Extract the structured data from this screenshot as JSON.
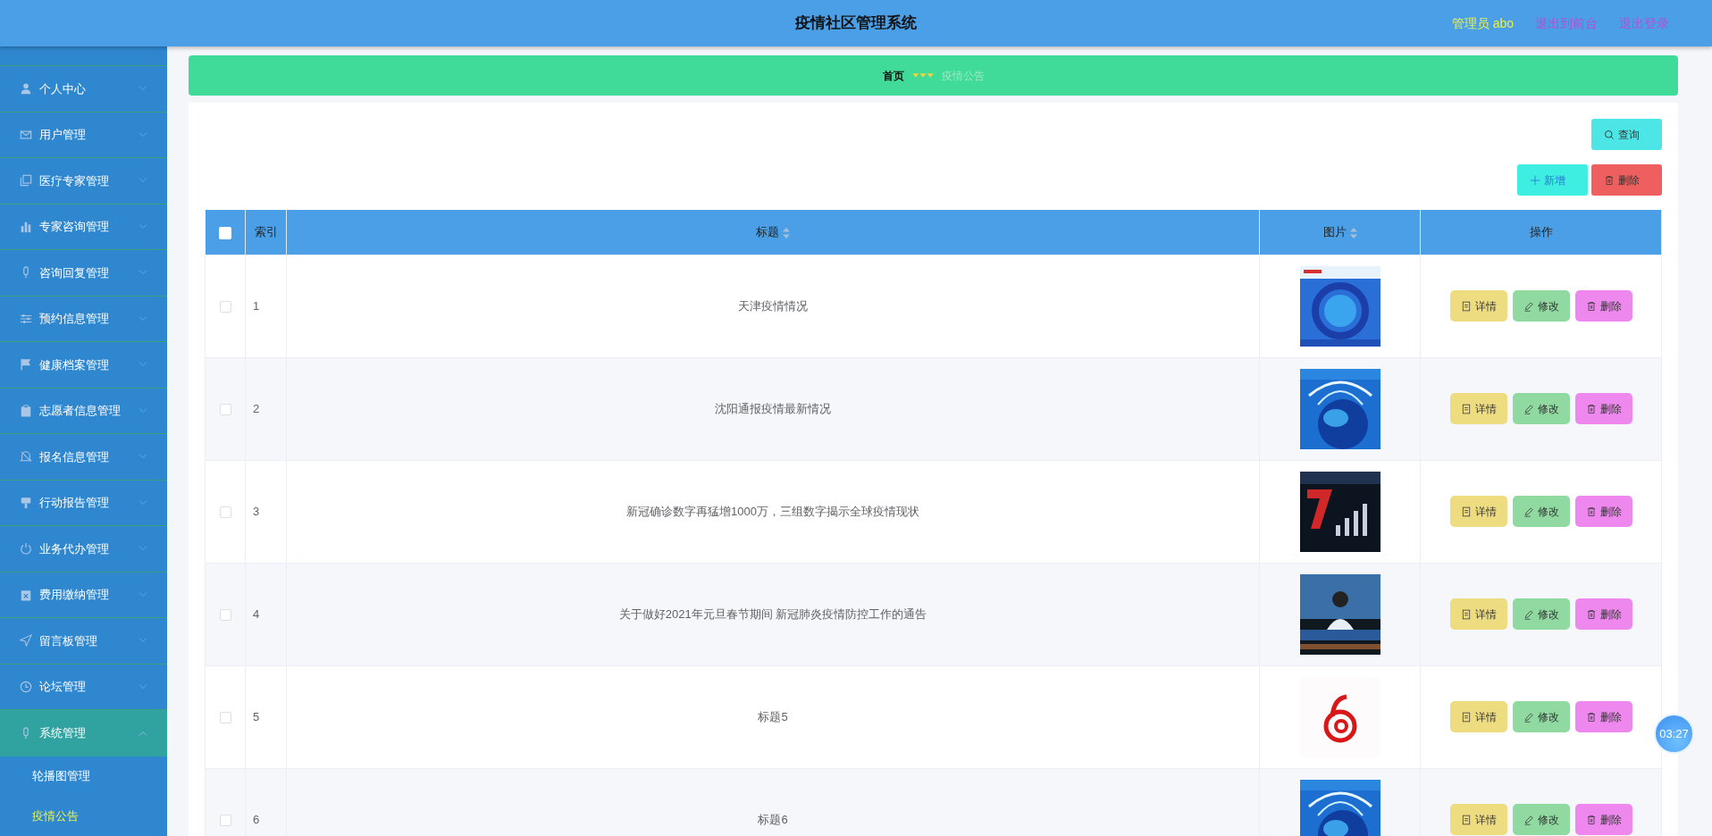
{
  "header": {
    "title": "疫情社区管理系统",
    "user": "管理员 abo",
    "links": [
      "退出到前台",
      "退出登录"
    ]
  },
  "sidebar": {
    "items": [
      {
        "label": "个人中心",
        "expanded": false
      },
      {
        "label": "用户管理",
        "expanded": false
      },
      {
        "label": "医疗专家管理",
        "expanded": false
      },
      {
        "label": "专家咨询管理",
        "expanded": false
      },
      {
        "label": "咨询回复管理",
        "expanded": false
      },
      {
        "label": "预约信息管理",
        "expanded": false
      },
      {
        "label": "健康档案管理",
        "expanded": false
      },
      {
        "label": "志愿者信息管理",
        "expanded": false
      },
      {
        "label": "报名信息管理",
        "expanded": false
      },
      {
        "label": "行动报告管理",
        "expanded": false
      },
      {
        "label": "业务代办管理",
        "expanded": false
      },
      {
        "label": "费用缴纳管理",
        "expanded": false
      },
      {
        "label": "留言板管理",
        "expanded": false
      },
      {
        "label": "论坛管理",
        "expanded": false
      },
      {
        "label": "系统管理",
        "expanded": true,
        "children": [
          {
            "label": "轮播图管理",
            "selected": false
          },
          {
            "label": "疫情公告",
            "selected": true
          }
        ]
      }
    ]
  },
  "breadcrumb": [
    "首页",
    "疫情公告"
  ],
  "toolbar": {
    "query": "查询",
    "add": "新增",
    "delete": "删除"
  },
  "table": {
    "all_checked": false,
    "columns": [
      {
        "label": "索引",
        "sortable": false
      },
      {
        "label": "标题",
        "sortable": true
      },
      {
        "label": "图片",
        "sortable": true
      },
      {
        "label": "操作",
        "sortable": false
      }
    ],
    "rows": [
      {
        "checked": false,
        "index": "1",
        "title": "天津疫情情况",
        "picture": {
          "kind": "picture"
        },
        "actions": [
          "详情",
          "修改",
          "删除"
        ]
      },
      {
        "checked": false,
        "index": "2",
        "title": "沈阳通报疫情最新情况",
        "picture": {
          "kind": "picture"
        },
        "actions": [
          "详情",
          "修改",
          "删除"
        ]
      },
      {
        "checked": false,
        "index": "3",
        "title": "新冠确诊数字再猛增1000万，三组数字揭示全球疫情现状",
        "picture": {
          "kind": "picture"
        },
        "actions": [
          "详情",
          "修改",
          "删除"
        ]
      },
      {
        "checked": false,
        "index": "4",
        "title": "关于做好2021年元旦春节期间 新冠肺炎疫情防控工作的通告",
        "picture": {
          "kind": "picture"
        },
        "actions": [
          "详情",
          "修改",
          "删除"
        ]
      },
      {
        "checked": false,
        "index": "5",
        "title": "标题5",
        "picture": {
          "kind": "picture"
        },
        "actions": [
          "详情",
          "修改",
          "删除"
        ]
      },
      {
        "checked": false,
        "index": "6",
        "title": "标题6",
        "picture": {
          "kind": "picture"
        },
        "actions": [
          "详情",
          "修改",
          "删除"
        ]
      }
    ]
  },
  "timer": "03:27"
}
